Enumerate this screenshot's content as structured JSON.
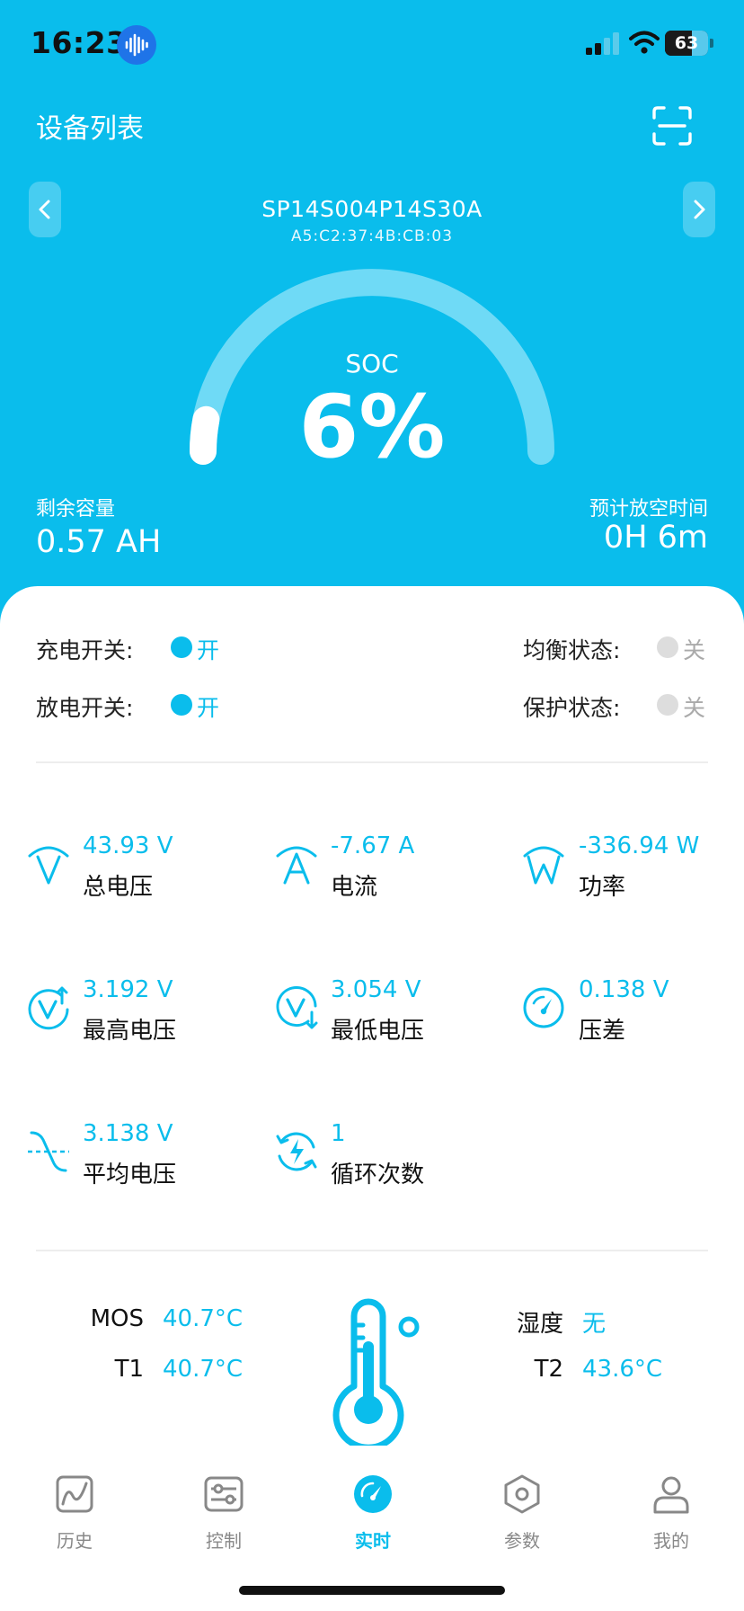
{
  "status_bar": {
    "time": "16:23",
    "battery_level": "63",
    "icons": [
      "sound-wave-icon",
      "cellular-signal-icon",
      "wifi-icon",
      "battery-icon"
    ]
  },
  "header": {
    "title": "设备列表",
    "scan_icon": "scan-icon",
    "prev_icon": "chevron-left-icon",
    "next_icon": "chevron-right-icon"
  },
  "device": {
    "name": "SP14S004P14S30A",
    "mac": "A5:C2:37:4B:CB:03"
  },
  "soc": {
    "label": "SOC",
    "value": "6%",
    "fraction": 0.06
  },
  "capacity": {
    "label": "剩余容量",
    "value": "0.57 AH"
  },
  "eta": {
    "label": "预计放空时间",
    "value": "0H 6m"
  },
  "switches": [
    {
      "label": "充电开关:",
      "value": "开",
      "on": true
    },
    {
      "label": "放电开关:",
      "value": "开",
      "on": true
    },
    {
      "label": "均衡状态:",
      "value": "关",
      "on": false
    },
    {
      "label": "保护状态:",
      "value": "关",
      "on": false
    }
  ],
  "metrics": [
    {
      "icon": "voltage-icon",
      "value": "43.93 V",
      "label": "总电压"
    },
    {
      "icon": "current-icon",
      "value": "-7.67 A",
      "label": "电流"
    },
    {
      "icon": "power-icon",
      "value": "-336.94 W",
      "label": "功率"
    },
    {
      "icon": "max-voltage-icon",
      "value": "3.192 V",
      "label": "最高电压"
    },
    {
      "icon": "min-voltage-icon",
      "value": "3.054 V",
      "label": "最低电压"
    },
    {
      "icon": "gauge-icon",
      "value": "0.138 V",
      "label": "压差"
    },
    {
      "icon": "average-voltage-icon",
      "value": "3.138 V",
      "label": "平均电压"
    },
    {
      "icon": "cycle-icon",
      "value": "1",
      "label": "循环次数"
    }
  ],
  "temps": {
    "mos": {
      "label": "MOS",
      "value": "40.7°C"
    },
    "t1": {
      "label": "T1",
      "value": "40.7°C"
    },
    "humidity": {
      "label": "湿度",
      "value": "无"
    },
    "t2": {
      "label": "T2",
      "value": "43.6°C"
    },
    "thermometer_icon": "thermometer-icon"
  },
  "tabs": [
    {
      "label": "历史",
      "icon": "history-chart-icon",
      "active": false
    },
    {
      "label": "控制",
      "icon": "sliders-icon",
      "active": false
    },
    {
      "label": "实时",
      "icon": "speedometer-icon",
      "active": true
    },
    {
      "label": "参数",
      "icon": "hexagon-nut-icon",
      "active": false
    },
    {
      "label": "我的",
      "icon": "user-icon",
      "active": false
    }
  ],
  "colors": {
    "primary": "#0ABDEC",
    "gauge_track": "#6FDAF6",
    "inactive": "#DDDDDD",
    "tab_inactive": "#888888"
  }
}
